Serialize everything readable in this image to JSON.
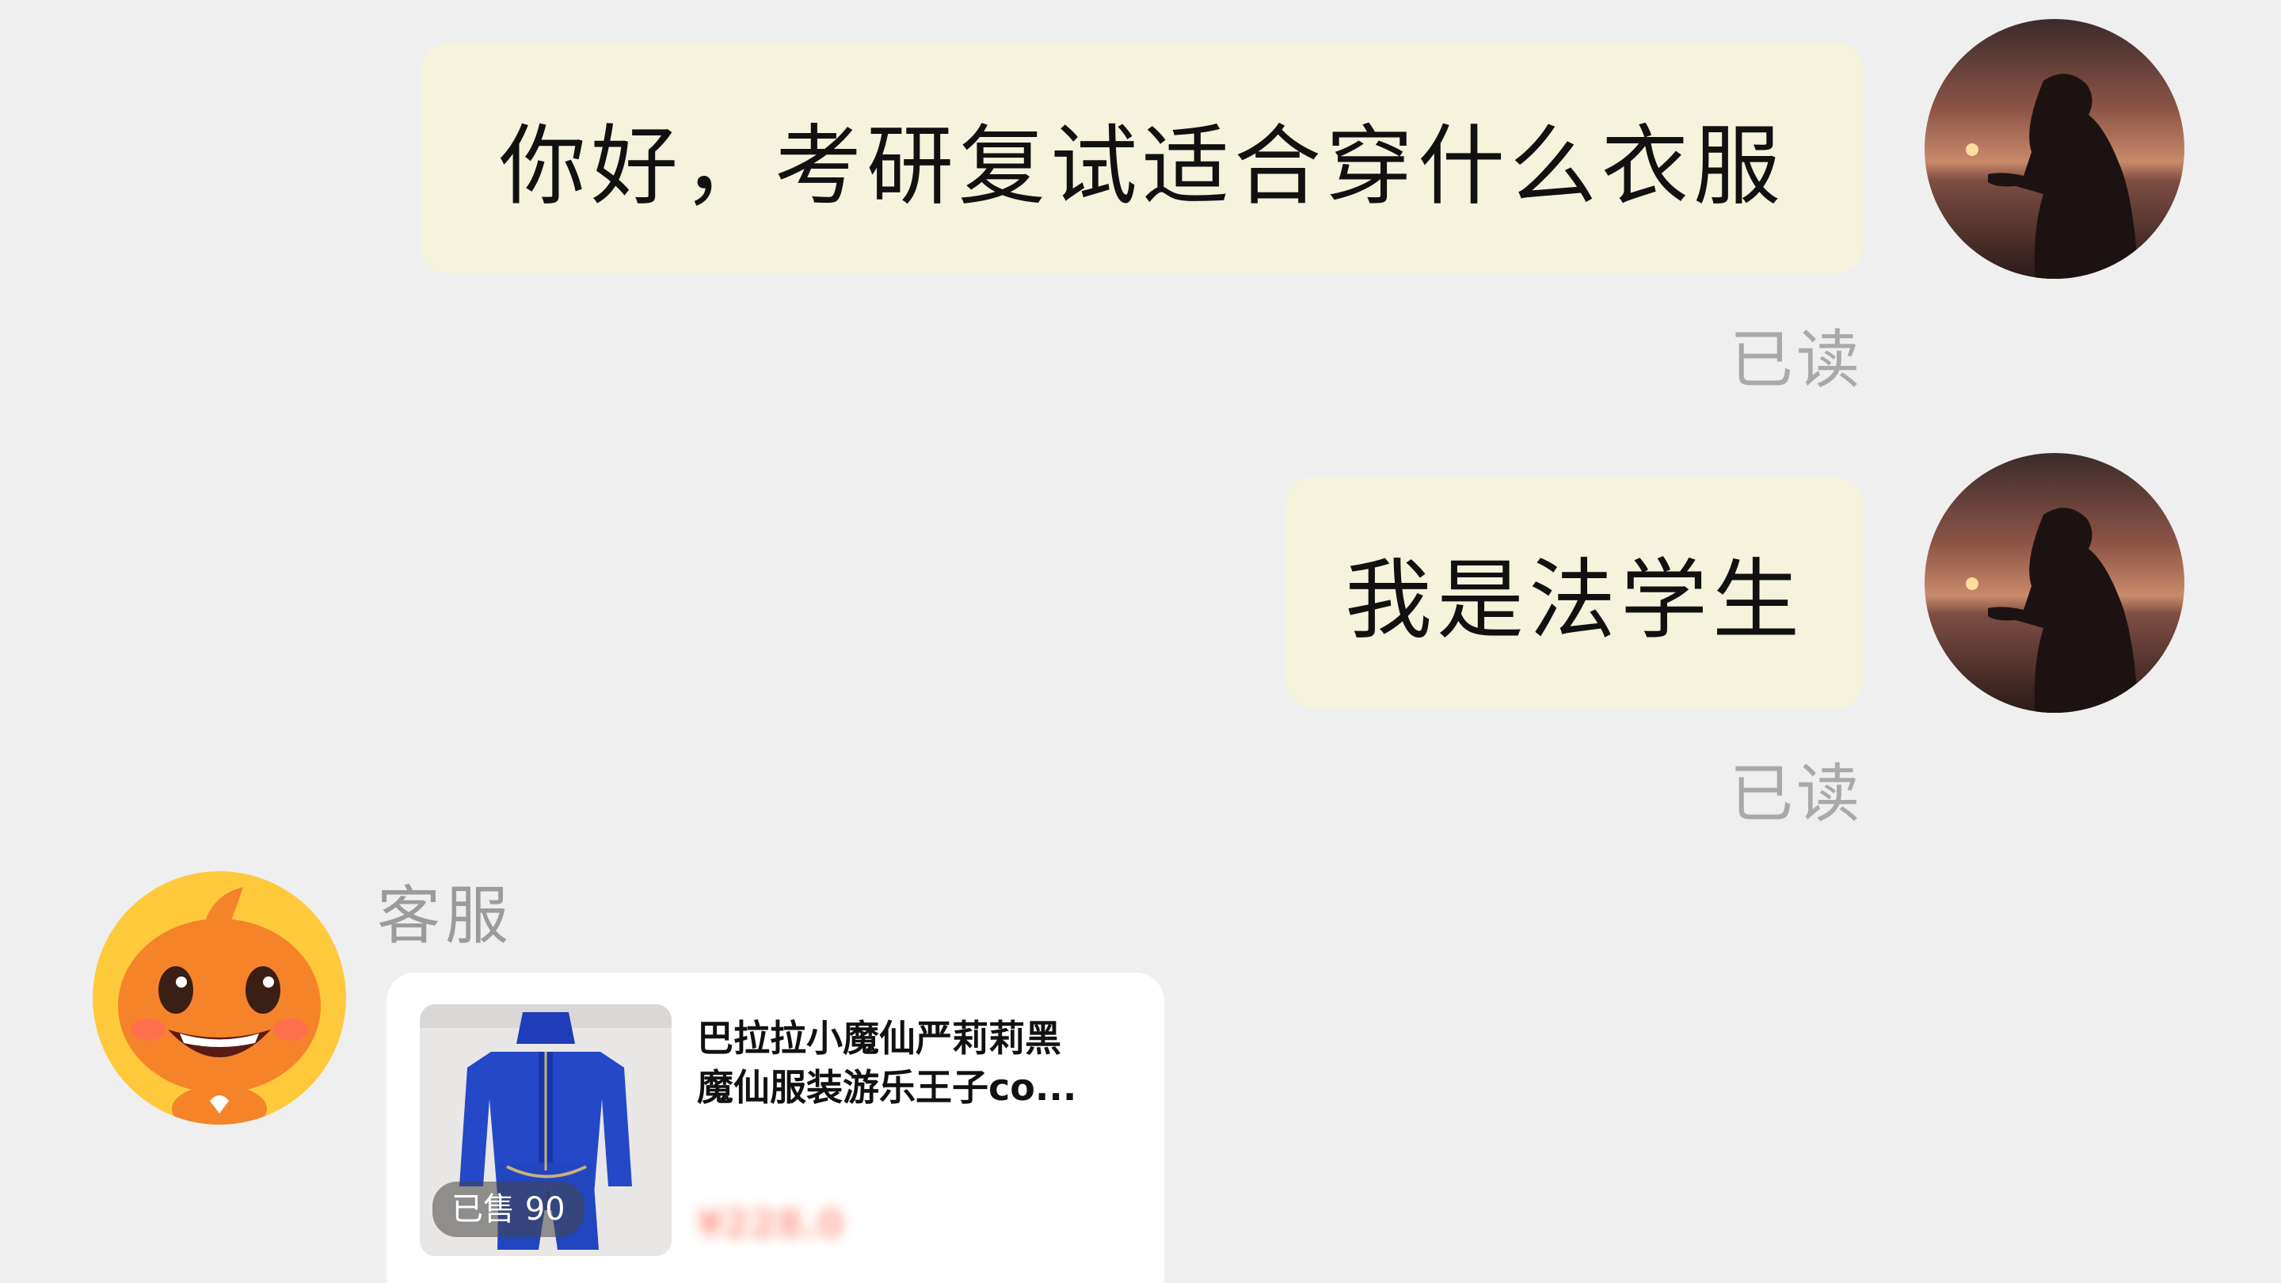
{
  "messages": [
    {
      "text": "你好，考研复试适合穿什么衣服",
      "status": "已读"
    },
    {
      "text": "我是法学生",
      "status": "已读"
    }
  ],
  "agent": {
    "name": "客服",
    "avatar_icon": "orange-mascot-icon"
  },
  "product": {
    "title_line1": "巴拉拉小魔仙严莉莉黑",
    "title_line2": "魔仙服装游乐王子co...",
    "sold": "已售 90",
    "price": "¥228.0"
  },
  "colors": {
    "background": "#efefef",
    "outgoing_bubble": "#f5f3dc",
    "card": "#ffffff",
    "muted_text": "#a9a9a9",
    "price": "#ff5a3c"
  }
}
